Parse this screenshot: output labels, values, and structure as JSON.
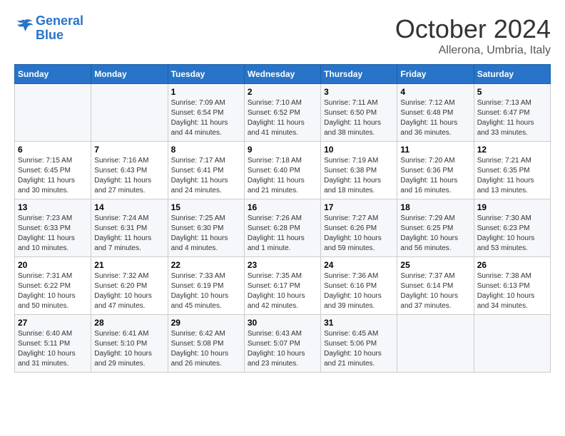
{
  "header": {
    "logo_line1": "General",
    "logo_line2": "Blue",
    "month": "October 2024",
    "location": "Allerona, Umbria, Italy"
  },
  "weekdays": [
    "Sunday",
    "Monday",
    "Tuesday",
    "Wednesday",
    "Thursday",
    "Friday",
    "Saturday"
  ],
  "weeks": [
    [
      {
        "day": "",
        "info": ""
      },
      {
        "day": "",
        "info": ""
      },
      {
        "day": "1",
        "info": "Sunrise: 7:09 AM\nSunset: 6:54 PM\nDaylight: 11 hours and 44 minutes."
      },
      {
        "day": "2",
        "info": "Sunrise: 7:10 AM\nSunset: 6:52 PM\nDaylight: 11 hours and 41 minutes."
      },
      {
        "day": "3",
        "info": "Sunrise: 7:11 AM\nSunset: 6:50 PM\nDaylight: 11 hours and 38 minutes."
      },
      {
        "day": "4",
        "info": "Sunrise: 7:12 AM\nSunset: 6:48 PM\nDaylight: 11 hours and 36 minutes."
      },
      {
        "day": "5",
        "info": "Sunrise: 7:13 AM\nSunset: 6:47 PM\nDaylight: 11 hours and 33 minutes."
      }
    ],
    [
      {
        "day": "6",
        "info": "Sunrise: 7:15 AM\nSunset: 6:45 PM\nDaylight: 11 hours and 30 minutes."
      },
      {
        "day": "7",
        "info": "Sunrise: 7:16 AM\nSunset: 6:43 PM\nDaylight: 11 hours and 27 minutes."
      },
      {
        "day": "8",
        "info": "Sunrise: 7:17 AM\nSunset: 6:41 PM\nDaylight: 11 hours and 24 minutes."
      },
      {
        "day": "9",
        "info": "Sunrise: 7:18 AM\nSunset: 6:40 PM\nDaylight: 11 hours and 21 minutes."
      },
      {
        "day": "10",
        "info": "Sunrise: 7:19 AM\nSunset: 6:38 PM\nDaylight: 11 hours and 18 minutes."
      },
      {
        "day": "11",
        "info": "Sunrise: 7:20 AM\nSunset: 6:36 PM\nDaylight: 11 hours and 16 minutes."
      },
      {
        "day": "12",
        "info": "Sunrise: 7:21 AM\nSunset: 6:35 PM\nDaylight: 11 hours and 13 minutes."
      }
    ],
    [
      {
        "day": "13",
        "info": "Sunrise: 7:23 AM\nSunset: 6:33 PM\nDaylight: 11 hours and 10 minutes."
      },
      {
        "day": "14",
        "info": "Sunrise: 7:24 AM\nSunset: 6:31 PM\nDaylight: 11 hours and 7 minutes."
      },
      {
        "day": "15",
        "info": "Sunrise: 7:25 AM\nSunset: 6:30 PM\nDaylight: 11 hours and 4 minutes."
      },
      {
        "day": "16",
        "info": "Sunrise: 7:26 AM\nSunset: 6:28 PM\nDaylight: 11 hours and 1 minute."
      },
      {
        "day": "17",
        "info": "Sunrise: 7:27 AM\nSunset: 6:26 PM\nDaylight: 10 hours and 59 minutes."
      },
      {
        "day": "18",
        "info": "Sunrise: 7:29 AM\nSunset: 6:25 PM\nDaylight: 10 hours and 56 minutes."
      },
      {
        "day": "19",
        "info": "Sunrise: 7:30 AM\nSunset: 6:23 PM\nDaylight: 10 hours and 53 minutes."
      }
    ],
    [
      {
        "day": "20",
        "info": "Sunrise: 7:31 AM\nSunset: 6:22 PM\nDaylight: 10 hours and 50 minutes."
      },
      {
        "day": "21",
        "info": "Sunrise: 7:32 AM\nSunset: 6:20 PM\nDaylight: 10 hours and 47 minutes."
      },
      {
        "day": "22",
        "info": "Sunrise: 7:33 AM\nSunset: 6:19 PM\nDaylight: 10 hours and 45 minutes."
      },
      {
        "day": "23",
        "info": "Sunrise: 7:35 AM\nSunset: 6:17 PM\nDaylight: 10 hours and 42 minutes."
      },
      {
        "day": "24",
        "info": "Sunrise: 7:36 AM\nSunset: 6:16 PM\nDaylight: 10 hours and 39 minutes."
      },
      {
        "day": "25",
        "info": "Sunrise: 7:37 AM\nSunset: 6:14 PM\nDaylight: 10 hours and 37 minutes."
      },
      {
        "day": "26",
        "info": "Sunrise: 7:38 AM\nSunset: 6:13 PM\nDaylight: 10 hours and 34 minutes."
      }
    ],
    [
      {
        "day": "27",
        "info": "Sunrise: 6:40 AM\nSunset: 5:11 PM\nDaylight: 10 hours and 31 minutes."
      },
      {
        "day": "28",
        "info": "Sunrise: 6:41 AM\nSunset: 5:10 PM\nDaylight: 10 hours and 29 minutes."
      },
      {
        "day": "29",
        "info": "Sunrise: 6:42 AM\nSunset: 5:08 PM\nDaylight: 10 hours and 26 minutes."
      },
      {
        "day": "30",
        "info": "Sunrise: 6:43 AM\nSunset: 5:07 PM\nDaylight: 10 hours and 23 minutes."
      },
      {
        "day": "31",
        "info": "Sunrise: 6:45 AM\nSunset: 5:06 PM\nDaylight: 10 hours and 21 minutes."
      },
      {
        "day": "",
        "info": ""
      },
      {
        "day": "",
        "info": ""
      }
    ]
  ]
}
